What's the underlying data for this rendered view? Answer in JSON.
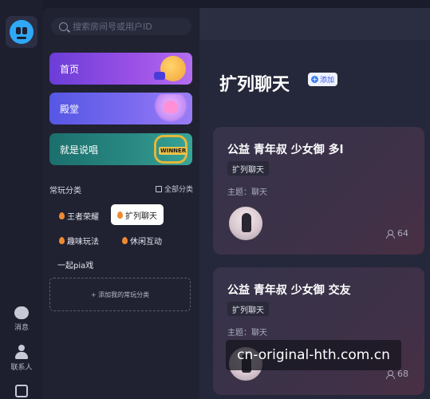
{
  "sidebar": {
    "items": [
      {
        "label": "消息",
        "icon": "message-icon"
      },
      {
        "label": "联系人",
        "icon": "contacts-icon"
      }
    ]
  },
  "search": {
    "placeholder": "搜索房间号或用户ID"
  },
  "banners": [
    {
      "label": "首页",
      "art": "emoji-megaphone"
    },
    {
      "label": "殿堂",
      "art": "heart-trophy"
    },
    {
      "label": "就是说唱",
      "art": "winner-chain"
    }
  ],
  "categories": {
    "title": "常玩分类",
    "all_label": "全部分类",
    "chips": [
      "王者荣耀",
      "扩列聊天",
      "趣味玩法",
      "休闲互动",
      "一起pia戏"
    ],
    "active": "扩列聊天",
    "add_label": "+ 添加我的常玩分类"
  },
  "main": {
    "title": "扩列聊天",
    "add_tag": "添加",
    "rooms": [
      {
        "title": "公益 青年叔 少女御 多l",
        "tag": "扩列聊天",
        "topic": "主题：聊天",
        "people": "64"
      },
      {
        "title": "公益 青年叔 少女御 交友",
        "tag": "扩列聊天",
        "topic": "主题：聊天",
        "people": "68"
      }
    ]
  },
  "watermark": "cn-original-hth.com.cn",
  "colors": {
    "accent": "#2fa8f7",
    "tag_blue": "#3b56e0",
    "chip_fire": "#f08a32"
  }
}
